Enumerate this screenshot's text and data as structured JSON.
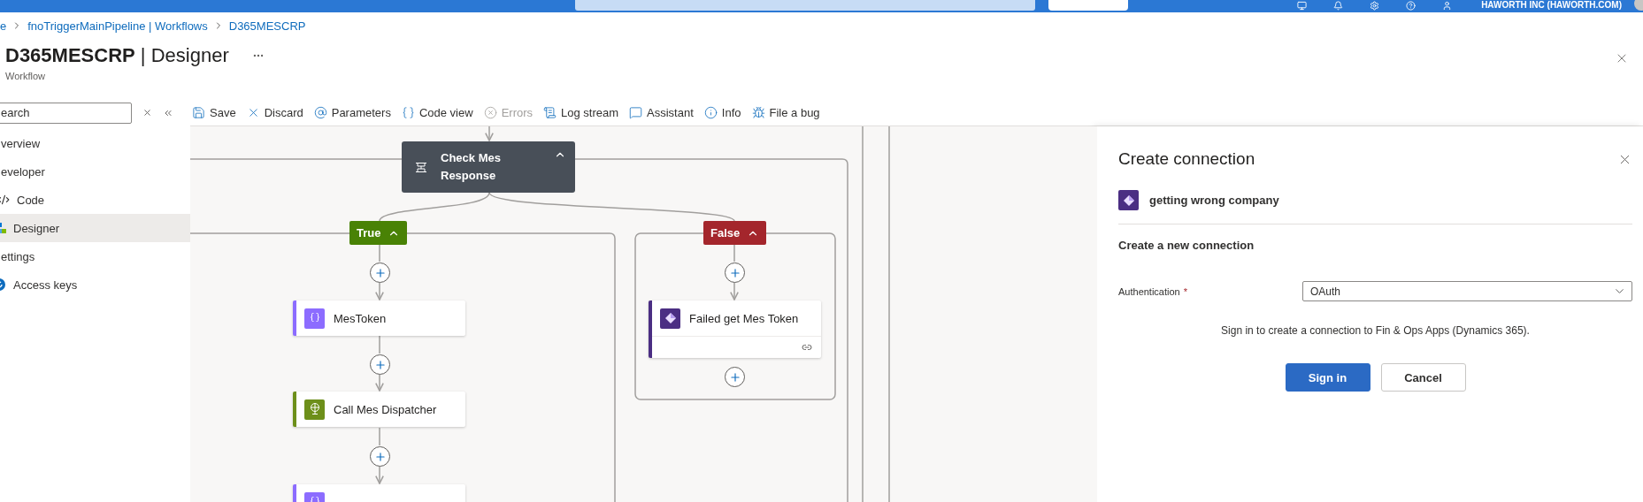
{
  "top_bar": {
    "tenant": "HAWORTH INC (HAWORTH.COM)"
  },
  "breadcrumb": [
    {
      "label": "e"
    },
    {
      "label": "fnoTriggerMainPipeline | Workflows"
    },
    {
      "label": "D365MESCRP"
    }
  ],
  "header": {
    "title": "**D365MESCRP** | Designer",
    "subtitle": "Workflow"
  },
  "nav": {
    "search_placeholder": "earch",
    "items": [
      {
        "label": "verview",
        "kind": "plain",
        "selected": false
      },
      {
        "label": "eveloper",
        "kind": "plain",
        "selected": false
      },
      {
        "label": "Code",
        "kind": "code",
        "selected": false
      },
      {
        "label": "Designer",
        "kind": "designer",
        "selected": true
      },
      {
        "label": "ettings",
        "kind": "plain",
        "selected": false
      },
      {
        "label": "Access keys",
        "kind": "keys",
        "selected": false
      }
    ]
  },
  "toolbar": [
    {
      "label": "Save",
      "kind": "save",
      "disabled": false
    },
    {
      "label": "Discard",
      "kind": "discard",
      "disabled": false
    },
    {
      "label": "Parameters",
      "kind": "parameters",
      "disabled": false
    },
    {
      "label": "Code view",
      "kind": "code",
      "disabled": false
    },
    {
      "label": "Errors",
      "kind": "errors",
      "disabled": true
    },
    {
      "label": "Log stream",
      "kind": "log",
      "disabled": false
    },
    {
      "label": "Assistant",
      "kind": "assistant",
      "disabled": false
    },
    {
      "label": "Info",
      "kind": "info",
      "disabled": false
    },
    {
      "label": "File a bug",
      "kind": "bug",
      "disabled": false
    }
  ],
  "canvas": {
    "condition": {
      "title": "Check Mes Response",
      "expanded": true
    },
    "branches": [
      {
        "label": "True",
        "color": "#498205",
        "expanded": true
      },
      {
        "label": "False",
        "color": "#a4262c",
        "expanded": true
      }
    ],
    "true_actions": [
      {
        "title": "MesToken",
        "kind": "variable"
      },
      {
        "title": "Call Mes Dispatcher",
        "kind": "http"
      },
      {
        "kind": "variable"
      }
    ],
    "false_actions": [
      {
        "title": "Failed get Mes Token",
        "kind": "fno"
      }
    ]
  },
  "panel": {
    "title": "Create connection",
    "connector": "getting wrong company",
    "section": "Create a new connection",
    "field": {
      "label": "Authentication",
      "required_mark": "*",
      "value": "OAuth"
    },
    "note": "Sign in to create a connection to Fin & Ops Apps (Dynamics 365).",
    "buttons": [
      {
        "label": "Sign in",
        "kind": "primary"
      },
      {
        "label": "Cancel",
        "kind": "secondary"
      }
    ]
  }
}
